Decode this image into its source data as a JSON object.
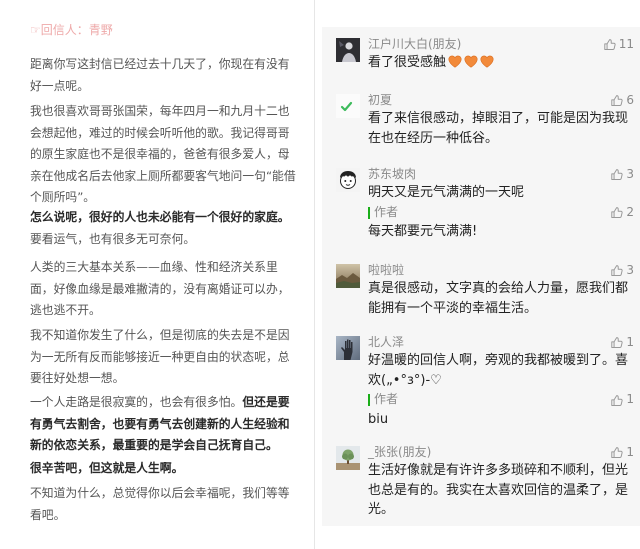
{
  "colors": {
    "header_pink": "#eea9a9",
    "author_bar_green": "#1aad19",
    "heart_orange": "#f28a3a",
    "panel_bg": "#f6f6f6"
  },
  "letter": {
    "header": "☞回信人：青野",
    "p1": [
      "距离你写这封信已经过去十几天了，你现在有没有",
      "好一点呢。"
    ],
    "p2": [
      "我也很喜欢哥哥张国荣，每年四月一和九月十二也",
      "会想起他，难过的时候会听听他的歌。我记得哥哥",
      "的原生家庭也不是很幸福的，爸爸有很多爱人，母",
      "亲在他成名后去他家上厕所都要客气地问一句“能借",
      "个厕所吗”。"
    ],
    "p3_bold": "怎么说呢，很好的人也未必能有一个很好的家庭。",
    "p3": "要看运气，也有很多无可奈何。",
    "p4": [
      "人类的三大基本关系——血缘、性和经济关系里",
      "面，好像血缘是最难撇清的，没有离婚证可以办，",
      "逃也逃不开。"
    ],
    "p5": [
      "我不知道你发生了什么，但是彻底的失去是不是因",
      "为一无所有反而能够接近一种更自由的状态呢，总",
      "要往好处想一想。"
    ],
    "p6_normal": "一个人走路是很寂寞的，也会有很多怕。",
    "p6_bold": [
      "但还是要",
      "有勇气去割舍，也要有勇气去创建新的人生经验和",
      "新的依恋关系，最重要的是学会自己抚育自己。"
    ],
    "p7_bold": "很辛苦吧，但这就是人生啊。",
    "p8": [
      "不知道为什么，总觉得你以后会幸福呢，我们等等",
      "看吧。"
    ]
  },
  "comments": [
    {
      "avatar": "dark-photo-avatar",
      "name": "江户川大白(朋友)",
      "likes": "11",
      "lines": [
        "看了很受感触"
      ],
      "emoji": [
        "orange-heart-icon",
        "orange-heart-icon",
        "orange-heart-icon"
      ]
    },
    {
      "avatar": "green-check-avatar",
      "name": "初夏",
      "likes": "6",
      "lines": [
        "看了来信很感动，掉眼泪了，可能是因为我现",
        "在也在经历一种低谷。"
      ]
    },
    {
      "avatar": "cartoon-face-avatar",
      "name": "苏东坡肉",
      "likes": "3",
      "lines": [
        "明天又是元气满满的一天呢"
      ],
      "reply": {
        "label": "作者",
        "likes": "2",
        "text": "每天都要元气满满!"
      }
    },
    {
      "avatar": "landscape-avatar",
      "name": "啦啦啦",
      "likes": "3",
      "lines": [
        "真是很感动，文字真的会给人力量，愿我们都",
        "能拥有一个平淡的幸福生活。"
      ]
    },
    {
      "avatar": "hand-photo-avatar",
      "name": "北人泽",
      "likes": "1",
      "lines": [
        "好温暖的回信人啊，旁观的我都被暖到了。喜",
        "欢(„•°з°)-♡"
      ],
      "reply": {
        "label": "作者",
        "likes": "1",
        "text": "biu"
      }
    },
    {
      "avatar": "tree-photo-avatar",
      "name": "_张张(朋友)",
      "likes": "1",
      "lines": [
        "生活好像就是有许许多多琐碎和不顺利，但光",
        "也总是有的。我实在太喜欢回信的温柔了，是",
        "光。"
      ]
    }
  ],
  "icons": {
    "like": "thumbs-up-icon"
  }
}
